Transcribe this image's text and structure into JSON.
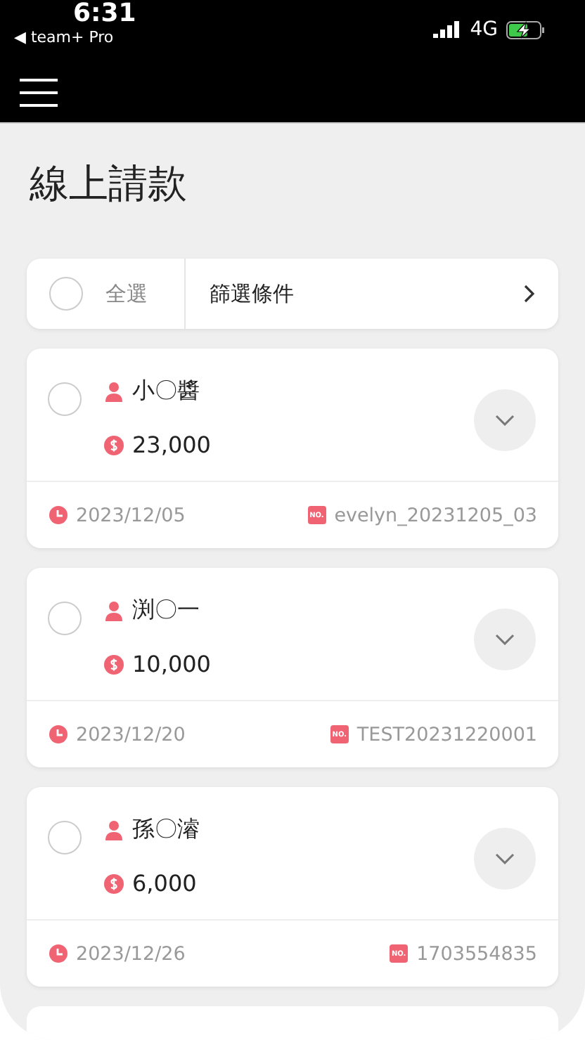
{
  "status_bar": {
    "time": "6:31",
    "back_app": "◀ team+ Pro",
    "network": "4G",
    "charging": true
  },
  "title": "線上請款",
  "filter_bar": {
    "select_all": {
      "label": "全選",
      "checked": false
    },
    "filter": {
      "label": "篩選條件"
    }
  },
  "requests": [
    {
      "name": "小〇醬",
      "amount": "23,000",
      "date": "2023/12/05",
      "badge": "NO.",
      "number": "evelyn_20231205_03",
      "checked": false
    },
    {
      "name": "渕〇一",
      "amount": "10,000",
      "date": "2023/12/20",
      "badge": "NO.",
      "number": "TEST20231220001",
      "checked": false
    },
    {
      "name": "孫〇濬",
      "amount": "6,000",
      "date": "2023/12/26",
      "badge": "NO.",
      "number": "1703554835",
      "checked": false
    }
  ]
}
